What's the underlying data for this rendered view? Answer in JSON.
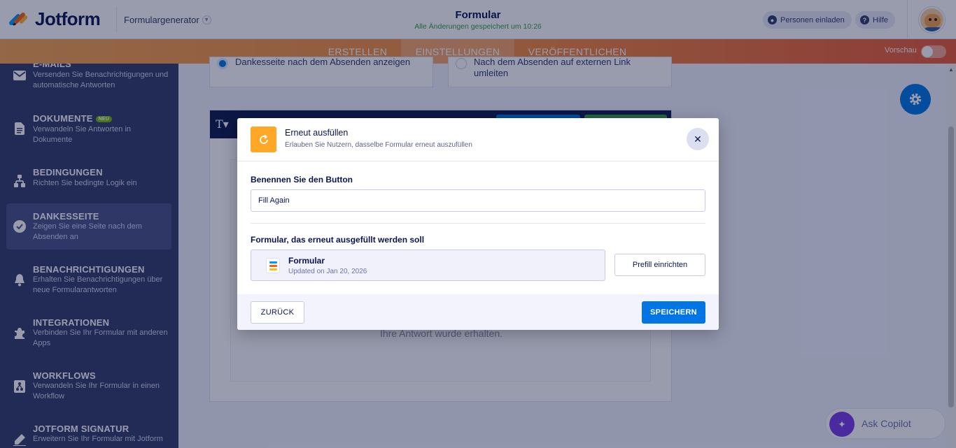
{
  "header": {
    "logo_text": "Jotform",
    "builder_mode": "Formulargenerator",
    "form_title": "Formular",
    "save_status": "Alle Änderungen gespeichert um 10:26",
    "invite_label": "Personen einladen",
    "help_label": "Hilfe"
  },
  "navbar": {
    "tabs": [
      {
        "label": "ERSTELLEN"
      },
      {
        "label": "EINSTELLUNGEN"
      },
      {
        "label": "VERÖFFENTLICHEN"
      }
    ],
    "preview_label": "Vorschau",
    "preview_on": false
  },
  "sidebar": {
    "items": [
      {
        "title": "E-MAILS",
        "desc": "Versenden Sie Benachrichtigungen und automatische Antworten",
        "icon": "mail-icon"
      },
      {
        "title": "DOKUMENTE",
        "badge": "NEU",
        "desc": "Verwandeln Sie Antworten in Dokumente",
        "icon": "document-icon"
      },
      {
        "title": "BEDINGUNGEN",
        "desc": "Richten Sie bedingte Logik ein",
        "icon": "conditions-icon"
      },
      {
        "title": "DANKESSEITE",
        "desc": "Zeigen Sie eine Seite nach dem Absenden an",
        "icon": "check-circle-icon",
        "active": true
      },
      {
        "title": "BENACHRICHTIGUNGEN",
        "desc": "Erhalten Sie Benachrichtigungen über neue Formularantworten",
        "icon": "bell-icon"
      },
      {
        "title": "INTEGRATIONEN",
        "desc": "Verbinden Sie Ihr Formular mit anderen Apps",
        "icon": "puzzle-icon"
      },
      {
        "title": "WORKFLOWS",
        "desc": "Verwandeln Sie Ihr Formular in einen Workflow",
        "icon": "workflow-icon"
      },
      {
        "title": "JOTFORM SIGNATUR",
        "desc": "Erweitern Sie Ihr Formular mit Jotform",
        "icon": "signature-icon"
      }
    ]
  },
  "main": {
    "option_left": "Dankesseite nach dem Absenden anzeigen",
    "option_right": "Nach dem Absenden auf externen Link umleiten",
    "thanks_message": "Ihre Antwort wurde erhalten.",
    "copilot_label": "Ask Copilot"
  },
  "modal": {
    "title": "Erneut ausfüllen",
    "subtitle": "Erlauben Sie Nutzern, dasselbe Formular erneut auszufüllen",
    "button_name_label": "Benennen Sie den Button",
    "button_name_value": "Fill Again",
    "form_label": "Formular, das erneut ausgefüllt werden soll",
    "form_name": "Formular",
    "form_updated": "Updated on Jan 20, 2026",
    "prefill_label": "Prefill einrichten",
    "back_label": "ZURÜCK",
    "save_label": "SPEICHERN"
  },
  "colors": {
    "accent": "#0075e3",
    "sidebar_bg": "#343c6a",
    "modal_icon": "#ffa726",
    "nav_gradient_start": "#f7a450",
    "nav_gradient_end": "#ec5a36"
  }
}
